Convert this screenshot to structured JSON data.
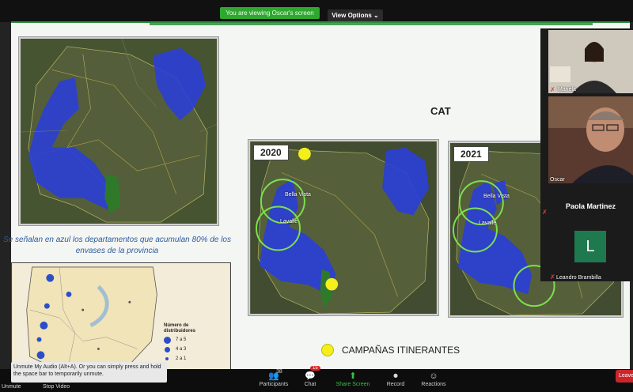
{
  "top_bar": {
    "banner": "You are viewing Oscar's screen",
    "view_options": "View Options ⌄"
  },
  "slide": {
    "caption": "Se señalan en azul los departamentos que acumulan 80% de los envases de la provincia",
    "legend": {
      "title": "Número de distribuidores",
      "rows": [
        "7 a 5",
        "4 a 3",
        "2 a 1"
      ]
    },
    "cat_title": "CAT",
    "year_2020": "2020",
    "year_2021": "2021",
    "town_bella_vista": "Bella Vista",
    "town_lavalle": "Lavalle",
    "campaigns_label": "CAMPAÑAS ITINERANTES",
    "colors": {
      "highlight_blue": "#2b3fd6",
      "campaign_yellow": "#f4ee1a",
      "circle_green": "#7de04f"
    }
  },
  "participants_panel": {
    "mariela": "Mariela",
    "oscar": "Oscar",
    "paola": "Paola Martinez",
    "leandro": "Leandro Brambilla",
    "leandro_avatar": "L"
  },
  "bottom_bar": {
    "unmute_tip": "Unmute My Audio (Alt+A). Or you can simply press and hold the space bar to temporarily unmute.",
    "unmute": "Unmute",
    "stop_video": "Stop Video",
    "participants": "Participants",
    "participants_count": "38",
    "chat": "Chat",
    "chat_badge": "15",
    "share_screen": "Share Screen",
    "record": "Record",
    "reactions": "Reactions",
    "leave": "Leave",
    "icons": {
      "participants": "people-icon",
      "chat": "chat-bubble-icon",
      "share": "share-screen-icon",
      "record": "record-icon",
      "reactions": "smiley-icon"
    }
  }
}
